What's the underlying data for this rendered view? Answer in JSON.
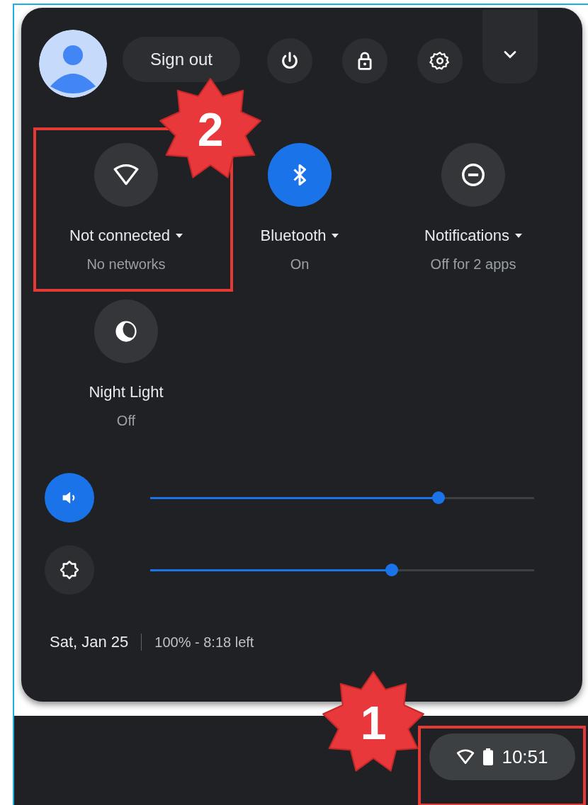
{
  "account": {
    "sign_out": "Sign out"
  },
  "tiles": [
    {
      "kind": "network",
      "label": "Not connected",
      "status": "No networks",
      "on": false
    },
    {
      "kind": "bluetooth",
      "label": "Bluetooth",
      "status": "On",
      "on": true
    },
    {
      "kind": "notifications",
      "label": "Notifications",
      "status": "Off for 2 apps",
      "on": false
    },
    {
      "kind": "night_light",
      "label": "Night Light",
      "status": "Off",
      "on": false
    }
  ],
  "sliders": [
    {
      "kind": "volume",
      "on": true,
      "level": 0.75
    },
    {
      "kind": "brightness",
      "on": false,
      "level": 0.63
    }
  ],
  "footer": {
    "date": "Sat, Jan 25",
    "battery": "100% - 8:18 left"
  },
  "shelf": {
    "time": "10:51"
  },
  "callouts": [
    {
      "number": "2"
    },
    {
      "number": "1"
    }
  ]
}
